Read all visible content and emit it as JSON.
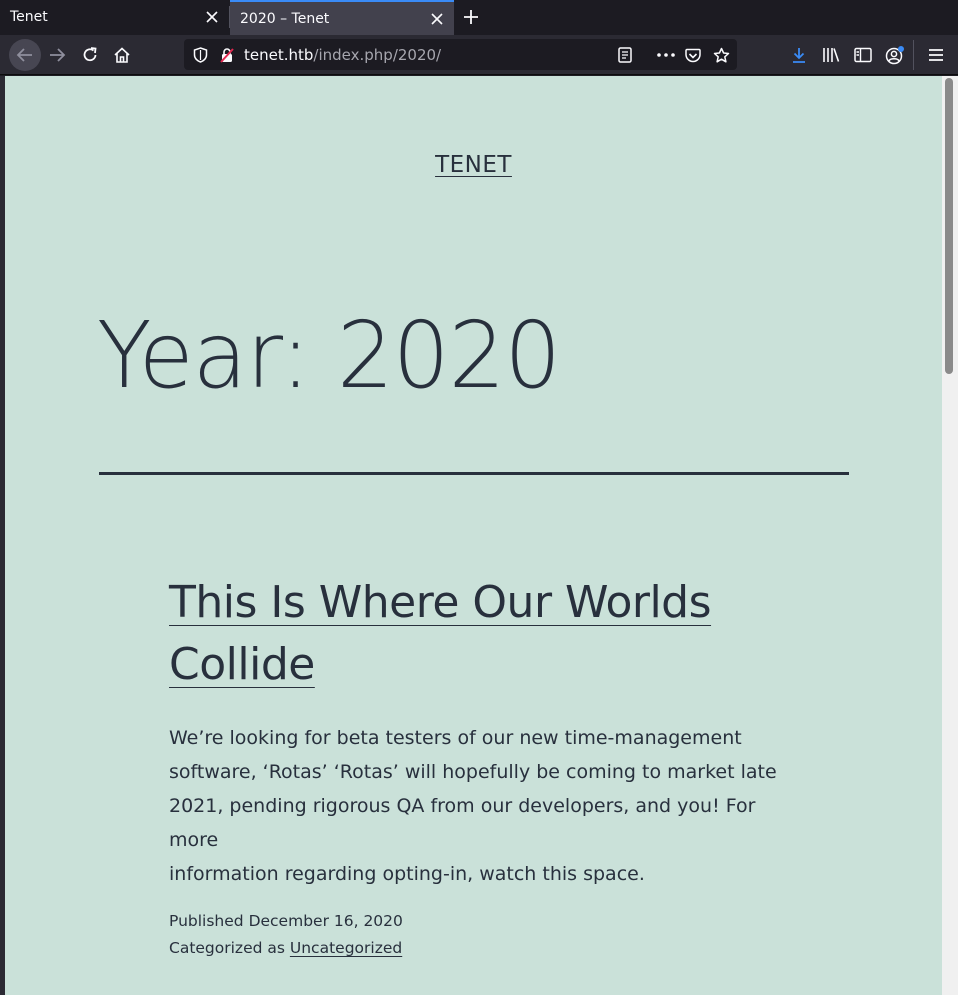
{
  "browser": {
    "tabs": [
      {
        "title": "Tenet",
        "active": false
      },
      {
        "title": "2020 – Tenet",
        "active": true
      }
    ],
    "url_host": "tenet.htb",
    "url_path": "/index.php/2020/",
    "accent_color": "#3a8bf6"
  },
  "site": {
    "title": "TENET",
    "background_color": "#cae1d9",
    "text_color": "#28303d"
  },
  "archive": {
    "heading": "Year: 2020"
  },
  "post": {
    "title_line1": "This Is Where Our Worlds",
    "title_line2": "Collide",
    "excerpt_line1": "We’re looking for beta testers of our new time-management",
    "excerpt_line2": "software, ‘Rotas’ ‘Rotas’ will hopefully be coming to market late",
    "excerpt_line3": "2021, pending rigorous QA from our developers, and you! For more",
    "excerpt_line4": "information regarding opting-in, watch this space.",
    "published_label": "Published",
    "published_date": "December 16, 2020",
    "category_label": "Categorized as",
    "category": "Uncategorized"
  }
}
